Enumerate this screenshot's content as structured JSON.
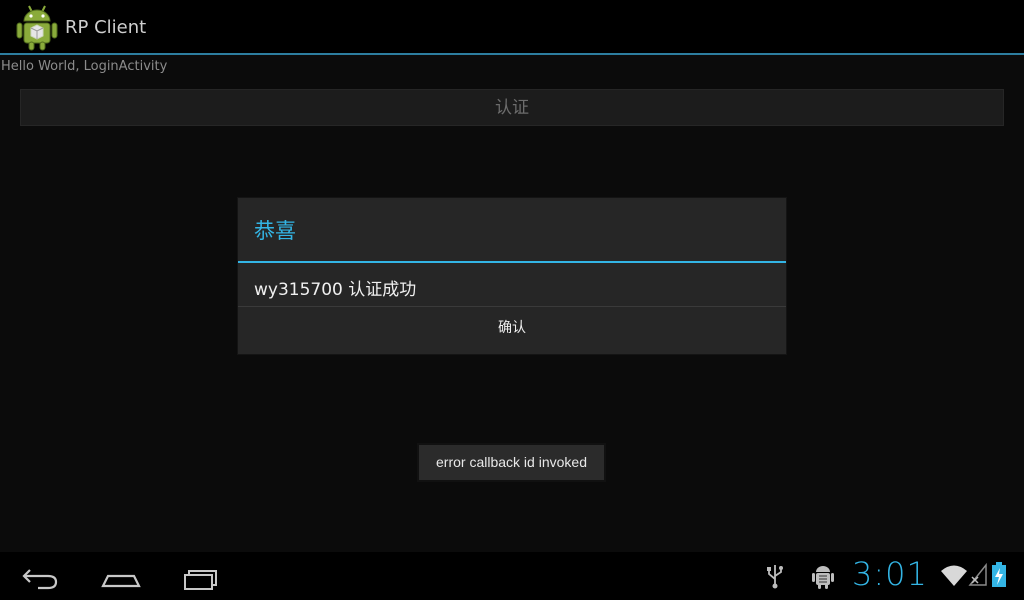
{
  "app": {
    "title": "RP Client"
  },
  "content": {
    "hello_text": "Hello World, LoginActivity",
    "auth_button_label": "认证"
  },
  "dialog": {
    "title": "恭喜",
    "message": "wy315700 认证成功",
    "confirm_label": "确认"
  },
  "toast": {
    "text": "error callback id invoked"
  },
  "status": {
    "time": "3:01"
  },
  "icons": {
    "app": "android-robot-icon",
    "back": "back-icon",
    "home": "home-icon",
    "recents": "recents-icon",
    "usb": "usb-icon",
    "debug": "android-debug-icon",
    "wifi": "wifi-icon",
    "signal": "no-signal-icon",
    "battery": "battery-charging-icon"
  },
  "colors": {
    "accent": "#33b5e5",
    "background": "#0b0b0b"
  }
}
